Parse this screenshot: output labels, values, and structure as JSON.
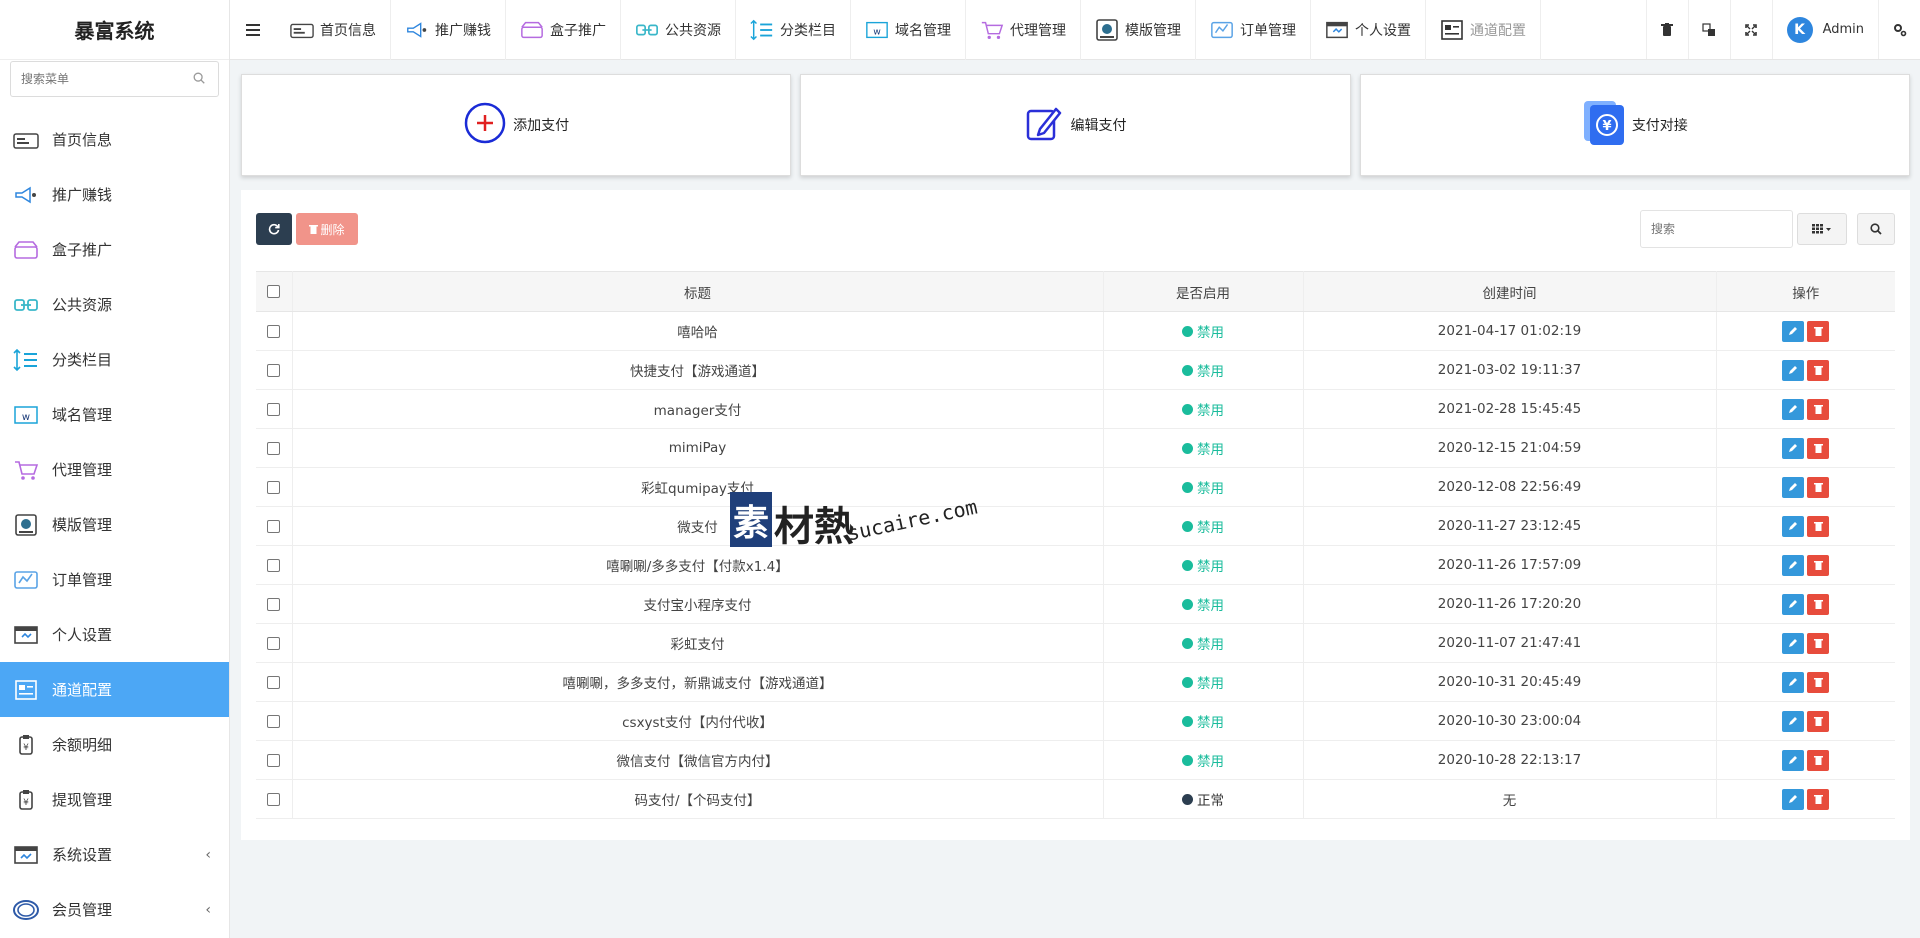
{
  "app": {
    "title": "暴富系统"
  },
  "sidebar": {
    "search_placeholder": "搜索菜单",
    "items": [
      {
        "label": "首页信息",
        "icon": "dashboard-icon"
      },
      {
        "label": "推广赚钱",
        "icon": "megaphone-icon"
      },
      {
        "label": "盒子推广",
        "icon": "box-icon"
      },
      {
        "label": "公共资源",
        "icon": "link-icon"
      },
      {
        "label": "分类栏目",
        "icon": "list-icon"
      },
      {
        "label": "域名管理",
        "icon": "domain-icon"
      },
      {
        "label": "代理管理",
        "icon": "cart-icon"
      },
      {
        "label": "模版管理",
        "icon": "template-icon"
      },
      {
        "label": "订单管理",
        "icon": "order-icon"
      },
      {
        "label": "个人设置",
        "icon": "settings-card-icon"
      },
      {
        "label": "通道配置",
        "icon": "channel-icon",
        "active": true
      },
      {
        "label": "余额明细",
        "icon": "balance-icon"
      },
      {
        "label": "提现管理",
        "icon": "withdraw-icon"
      },
      {
        "label": "系统设置",
        "icon": "system-icon",
        "has_children": true
      },
      {
        "label": "会员管理",
        "icon": "member-icon",
        "has_children": true
      }
    ]
  },
  "topnav": {
    "items": [
      "首页信息",
      "推广赚钱",
      "盒子推广",
      "公共资源",
      "分类栏目",
      "域名管理",
      "代理管理",
      "模版管理",
      "订单管理",
      "个人设置",
      "通道配置"
    ],
    "user": "Admin"
  },
  "cards": {
    "add": "添加支付",
    "edit": "编辑支付",
    "connect": "支付对接"
  },
  "toolbar": {
    "delete_label": "删除",
    "search_placeholder": "搜索"
  },
  "table": {
    "headers": {
      "title": "标题",
      "enabled": "是否启用",
      "created": "创建时间",
      "ops": "操作"
    },
    "rows": [
      {
        "title": "嘻哈哈",
        "status": "禁用",
        "created": "2021-04-17 01:02:19"
      },
      {
        "title": "快捷支付【游戏通道】",
        "status": "禁用",
        "created": "2021-03-02 19:11:37"
      },
      {
        "title": "manager支付",
        "status": "禁用",
        "created": "2021-02-28 15:45:45"
      },
      {
        "title": "mimiPay",
        "status": "禁用",
        "created": "2020-12-15 21:04:59"
      },
      {
        "title": "彩虹qumipay支付",
        "status": "禁用",
        "created": "2020-12-08 22:56:49"
      },
      {
        "title": "微支付",
        "status": "禁用",
        "created": "2020-11-27 23:12:45"
      },
      {
        "title": "嘻唰唰/多多支付【付款x1.4】",
        "status": "禁用",
        "created": "2020-11-26 17:57:09"
      },
      {
        "title": "支付宝小程序支付",
        "status": "禁用",
        "created": "2020-11-26 17:20:20"
      },
      {
        "title": "彩虹支付",
        "status": "禁用",
        "created": "2020-11-07 21:47:41"
      },
      {
        "title": "嘻唰唰，多多支付，新鼎诚支付【游戏通道】",
        "status": "禁用",
        "created": "2020-10-31 20:45:49"
      },
      {
        "title": "csxyst支付【内付代收】",
        "status": "禁用",
        "created": "2020-10-30 23:00:04"
      },
      {
        "title": "微信支付【微信官方内付】",
        "status": "禁用",
        "created": "2020-10-28 22:13:17"
      },
      {
        "title": "码支付/【个码支付】",
        "status": "正常",
        "created": "无"
      }
    ]
  },
  "watermark": {
    "brand": "素材熱",
    "url": "sucaire.com"
  },
  "colors": {
    "accent": "#4ca7f5",
    "disabled_status": "#1abc9c",
    "normal_status": "#2c3e50",
    "edit": "#3498db",
    "delete": "#e74c3c"
  }
}
